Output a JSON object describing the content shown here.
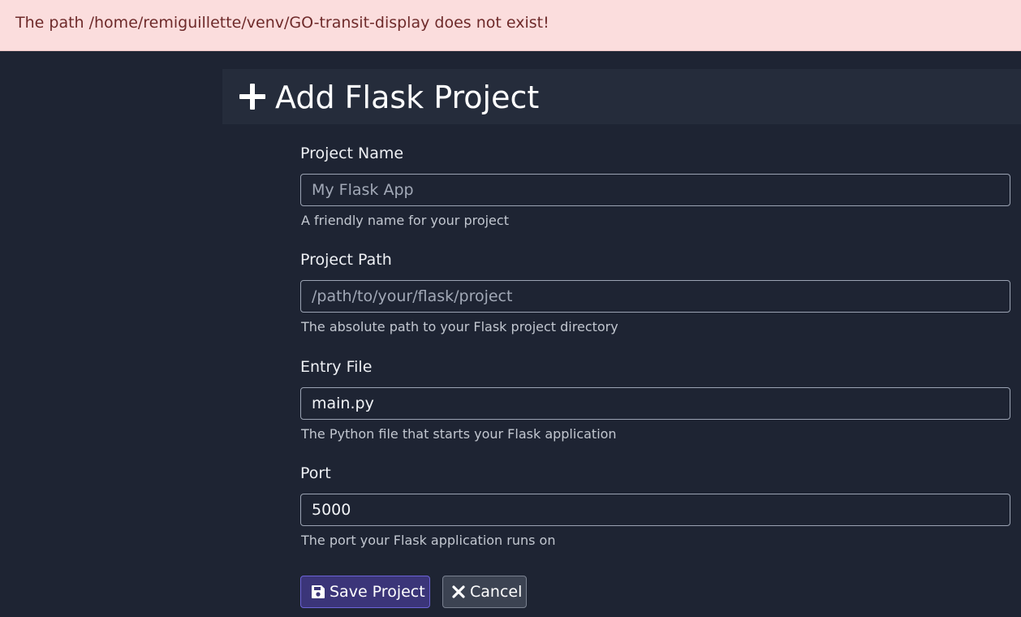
{
  "alert": {
    "message": "The path /home/remiguillette/venv/GO-transit-display does not exist!",
    "type": "danger"
  },
  "header": {
    "icon": "plus-icon",
    "title": "Add Flask Project"
  },
  "form": {
    "project_name": {
      "label": "Project Name",
      "value": "",
      "placeholder": "My Flask App",
      "help": "A friendly name for your project"
    },
    "project_path": {
      "label": "Project Path",
      "value": "",
      "placeholder": "/path/to/your/flask/project",
      "help": "The absolute path to your Flask project directory"
    },
    "entry_file": {
      "label": "Entry File",
      "value": "main.py",
      "placeholder": "",
      "help": "The Python file that starts your Flask application"
    },
    "port": {
      "label": "Port",
      "value": "5000",
      "placeholder": "",
      "help": "The port your Flask application runs on"
    }
  },
  "actions": {
    "save_label": "Save Project",
    "save_icon": "floppy-disk-icon",
    "cancel_label": "Cancel",
    "cancel_icon": "close-icon"
  },
  "colors": {
    "background": "#1e2433",
    "header_bg": "#252c3b",
    "alert_bg": "#fbdddd",
    "alert_text": "#6e2a2a",
    "primary": "#3b3579",
    "primary_border": "#6c63d6"
  }
}
